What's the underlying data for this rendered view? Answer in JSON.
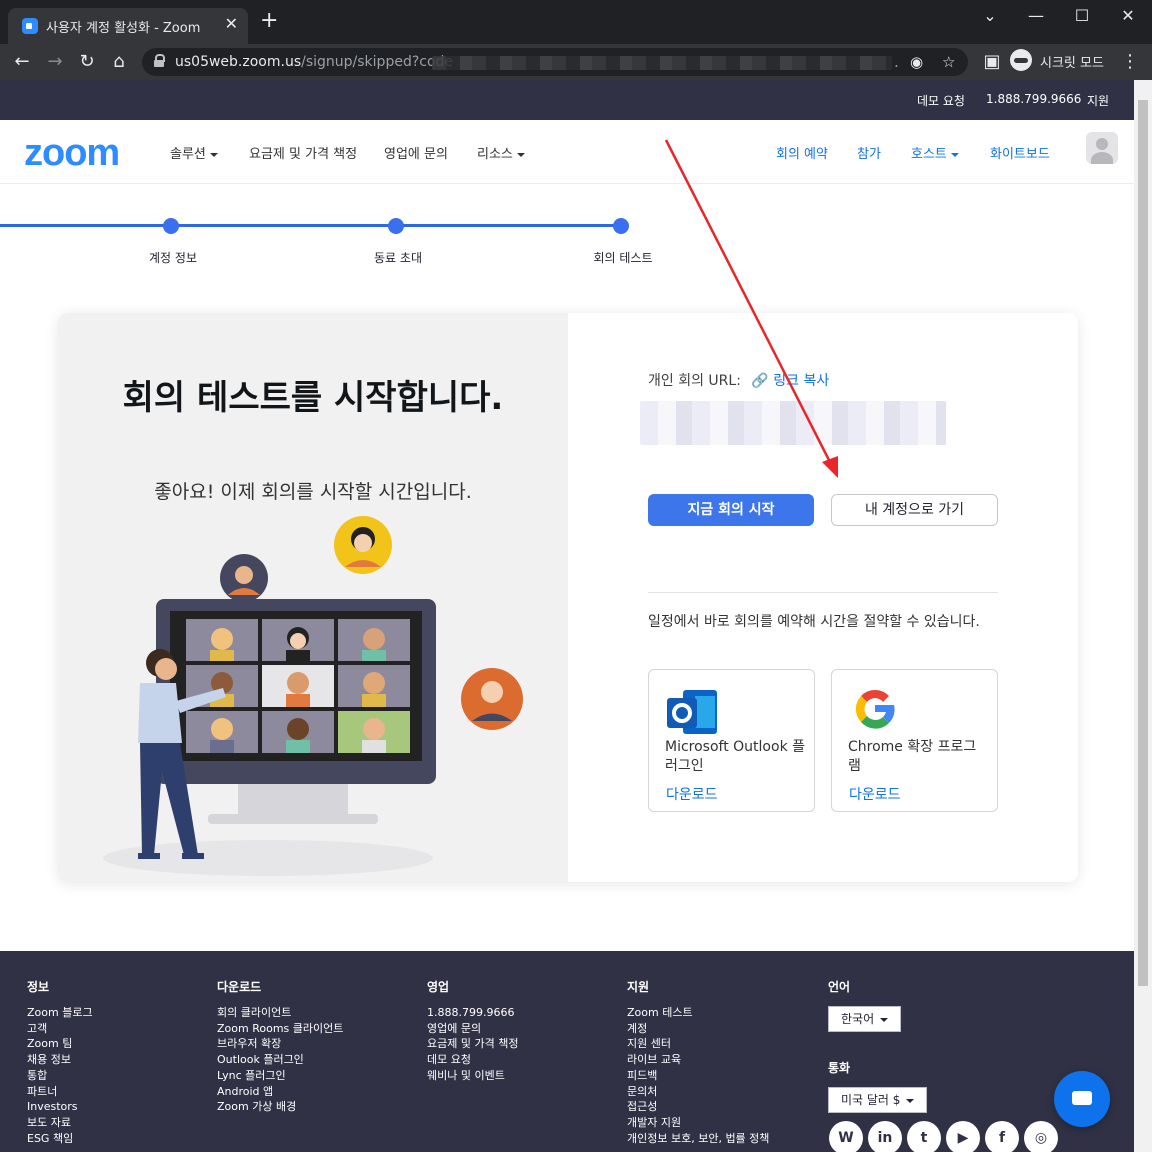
{
  "browser": {
    "tab_title": "사용자 계정 활성화 - Zoom",
    "new_tab": "+",
    "url_host": "us05web.zoom.us",
    "url_path": "/signup/skipped?code",
    "url_ellipsis": ".",
    "incognito_label": "시크릿 모드",
    "window_controls": [
      "⌄",
      "—",
      "☐",
      "✕"
    ]
  },
  "topbar": {
    "demo": "데모 요청",
    "phone": "1.888.799.9666",
    "support": "지원"
  },
  "nav": {
    "logo": "zoom",
    "left": [
      "솔루션",
      "요금제 및 가격 책정",
      "영업에 문의",
      "리소스"
    ],
    "right": [
      "회의 예약",
      "참가",
      "호스트",
      "화이트보드"
    ]
  },
  "steps": [
    "계정 정보",
    "동료 초대",
    "회의 테스트"
  ],
  "card": {
    "headline": "회의 테스트를 시작합니다.",
    "subline": "좋아요! 이제 회의를 시작할 시간입니다.",
    "url_label": "개인 회의 URL:",
    "copy_link": "링크 복사",
    "start_button": "지금 회의 시작",
    "account_button": "내 계정으로 가기",
    "schedule_text": "일정에서 바로 회의를 예약해 시간을 절약할 수 있습니다.",
    "plugins": [
      {
        "name": "Microsoft Outlook 플러그인",
        "download": "다운로드",
        "icon": "outlook-icon"
      },
      {
        "name": "Chrome 확장 프로그램",
        "download": "다운로드",
        "icon": "google-icon"
      }
    ]
  },
  "footer": {
    "columns": [
      {
        "title": "정보",
        "items": [
          "Zoom 블로그",
          "고객",
          "Zoom 팀",
          "채용 정보",
          "통합",
          "파트너",
          "Investors",
          "보도 자료",
          "ESG 책임"
        ]
      },
      {
        "title": "다운로드",
        "items": [
          "회의 클라이언트",
          "Zoom Rooms 클라이언트",
          "브라우저 확장",
          "Outlook 플러그인",
          "Lync 플러그인",
          "Android 앱",
          "Zoom 가상 배경"
        ]
      },
      {
        "title": "영업",
        "items": [
          "1.888.799.9666",
          "영업에 문의",
          "요금제 및 가격 책정",
          "데모 요청",
          "웨비나 및 이벤트"
        ]
      },
      {
        "title": "지원",
        "items": [
          "Zoom 테스트",
          "계정",
          "지원 센터",
          "라이브 교육",
          "피드백",
          "문의처",
          "접근성",
          "개발자 지원",
          "개인정보 보호, 보안, 법률 정책"
        ]
      }
    ],
    "language_title": "언어",
    "language_value": "한국어",
    "currency_title": "통화",
    "currency_value": "미국 달러 $",
    "social": [
      "W",
      "in",
      "t",
      "▶",
      "f",
      "◎"
    ]
  },
  "colors": {
    "brand_blue": "#2d8cff",
    "link_blue": "#0e72ed",
    "button_blue": "#3d76ea",
    "dark_bar": "#313145",
    "annotation_red": "#e8262b"
  }
}
